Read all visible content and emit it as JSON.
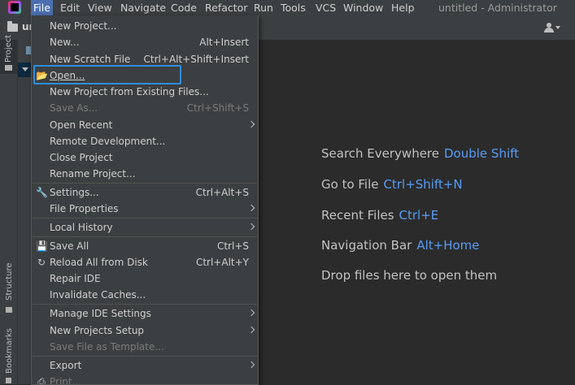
{
  "menubar": {
    "items": [
      {
        "id": "file",
        "label": "File"
      },
      {
        "id": "edit",
        "label": "Edit"
      },
      {
        "id": "view",
        "label": "View"
      },
      {
        "id": "navigate",
        "label": "Navigate"
      },
      {
        "id": "code",
        "label": "Code"
      },
      {
        "id": "refactor",
        "label": "Refactor"
      },
      {
        "id": "run",
        "label": "Run"
      },
      {
        "id": "tools",
        "label": "Tools"
      },
      {
        "id": "vcs",
        "label": "VCS"
      },
      {
        "id": "window",
        "label": "Window"
      },
      {
        "id": "help",
        "label": "Help"
      }
    ],
    "window_title": "untitled - Administrator"
  },
  "toolbar": {
    "breadcrumb_text": "ur"
  },
  "left_stripe": {
    "project_label": "Project",
    "structure_label": "Structure",
    "bookmarks_label": "Bookmarks"
  },
  "file_menu": {
    "items": [
      {
        "label": "New Project...",
        "shortcut": ""
      },
      {
        "label": "New...",
        "shortcut": "Alt+Insert"
      },
      {
        "label": "New Scratch File",
        "shortcut": "Ctrl+Alt+Shift+Insert"
      },
      {
        "label": "Open...",
        "shortcut": ""
      },
      {
        "label": "New Project from Existing Files...",
        "shortcut": ""
      },
      {
        "label": "Save As...",
        "shortcut": "Ctrl+Shift+S"
      },
      {
        "label": "Open Recent",
        "shortcut": ""
      },
      {
        "label": "Remote Development...",
        "shortcut": ""
      },
      {
        "label": "Close Project",
        "shortcut": ""
      },
      {
        "label": "Rename Project...",
        "shortcut": ""
      },
      {
        "label": "Settings...",
        "shortcut": "Ctrl+Alt+S"
      },
      {
        "label": "File Properties",
        "shortcut": ""
      },
      {
        "label": "Local History",
        "shortcut": ""
      },
      {
        "label": "Save All",
        "shortcut": "Ctrl+S"
      },
      {
        "label": "Reload All from Disk",
        "shortcut": "Ctrl+Alt+Y"
      },
      {
        "label": "Repair IDE",
        "shortcut": ""
      },
      {
        "label": "Invalidate Caches...",
        "shortcut": ""
      },
      {
        "label": "Manage IDE Settings",
        "shortcut": ""
      },
      {
        "label": "New Projects Setup",
        "shortcut": ""
      },
      {
        "label": "Save File as Template...",
        "shortcut": ""
      },
      {
        "label": "Export",
        "shortcut": ""
      },
      {
        "label": "Print...",
        "shortcut": ""
      }
    ]
  },
  "editor_hints": [
    {
      "text": "Search Everywhere",
      "key": "Double Shift"
    },
    {
      "text": "Go to File",
      "key": "Ctrl+Shift+N"
    },
    {
      "text": "Recent Files",
      "key": "Ctrl+E"
    },
    {
      "text": "Navigation Bar",
      "key": "Alt+Home"
    },
    {
      "text": "Drop files here to open them",
      "key": ""
    }
  ],
  "colors": {
    "accent": "#4b6eaf",
    "focus_ring": "#2f8dde",
    "shortcut_hint": "#589df6",
    "menu_bg": "#3c3f41",
    "editor_bg": "#2b2b2b"
  }
}
